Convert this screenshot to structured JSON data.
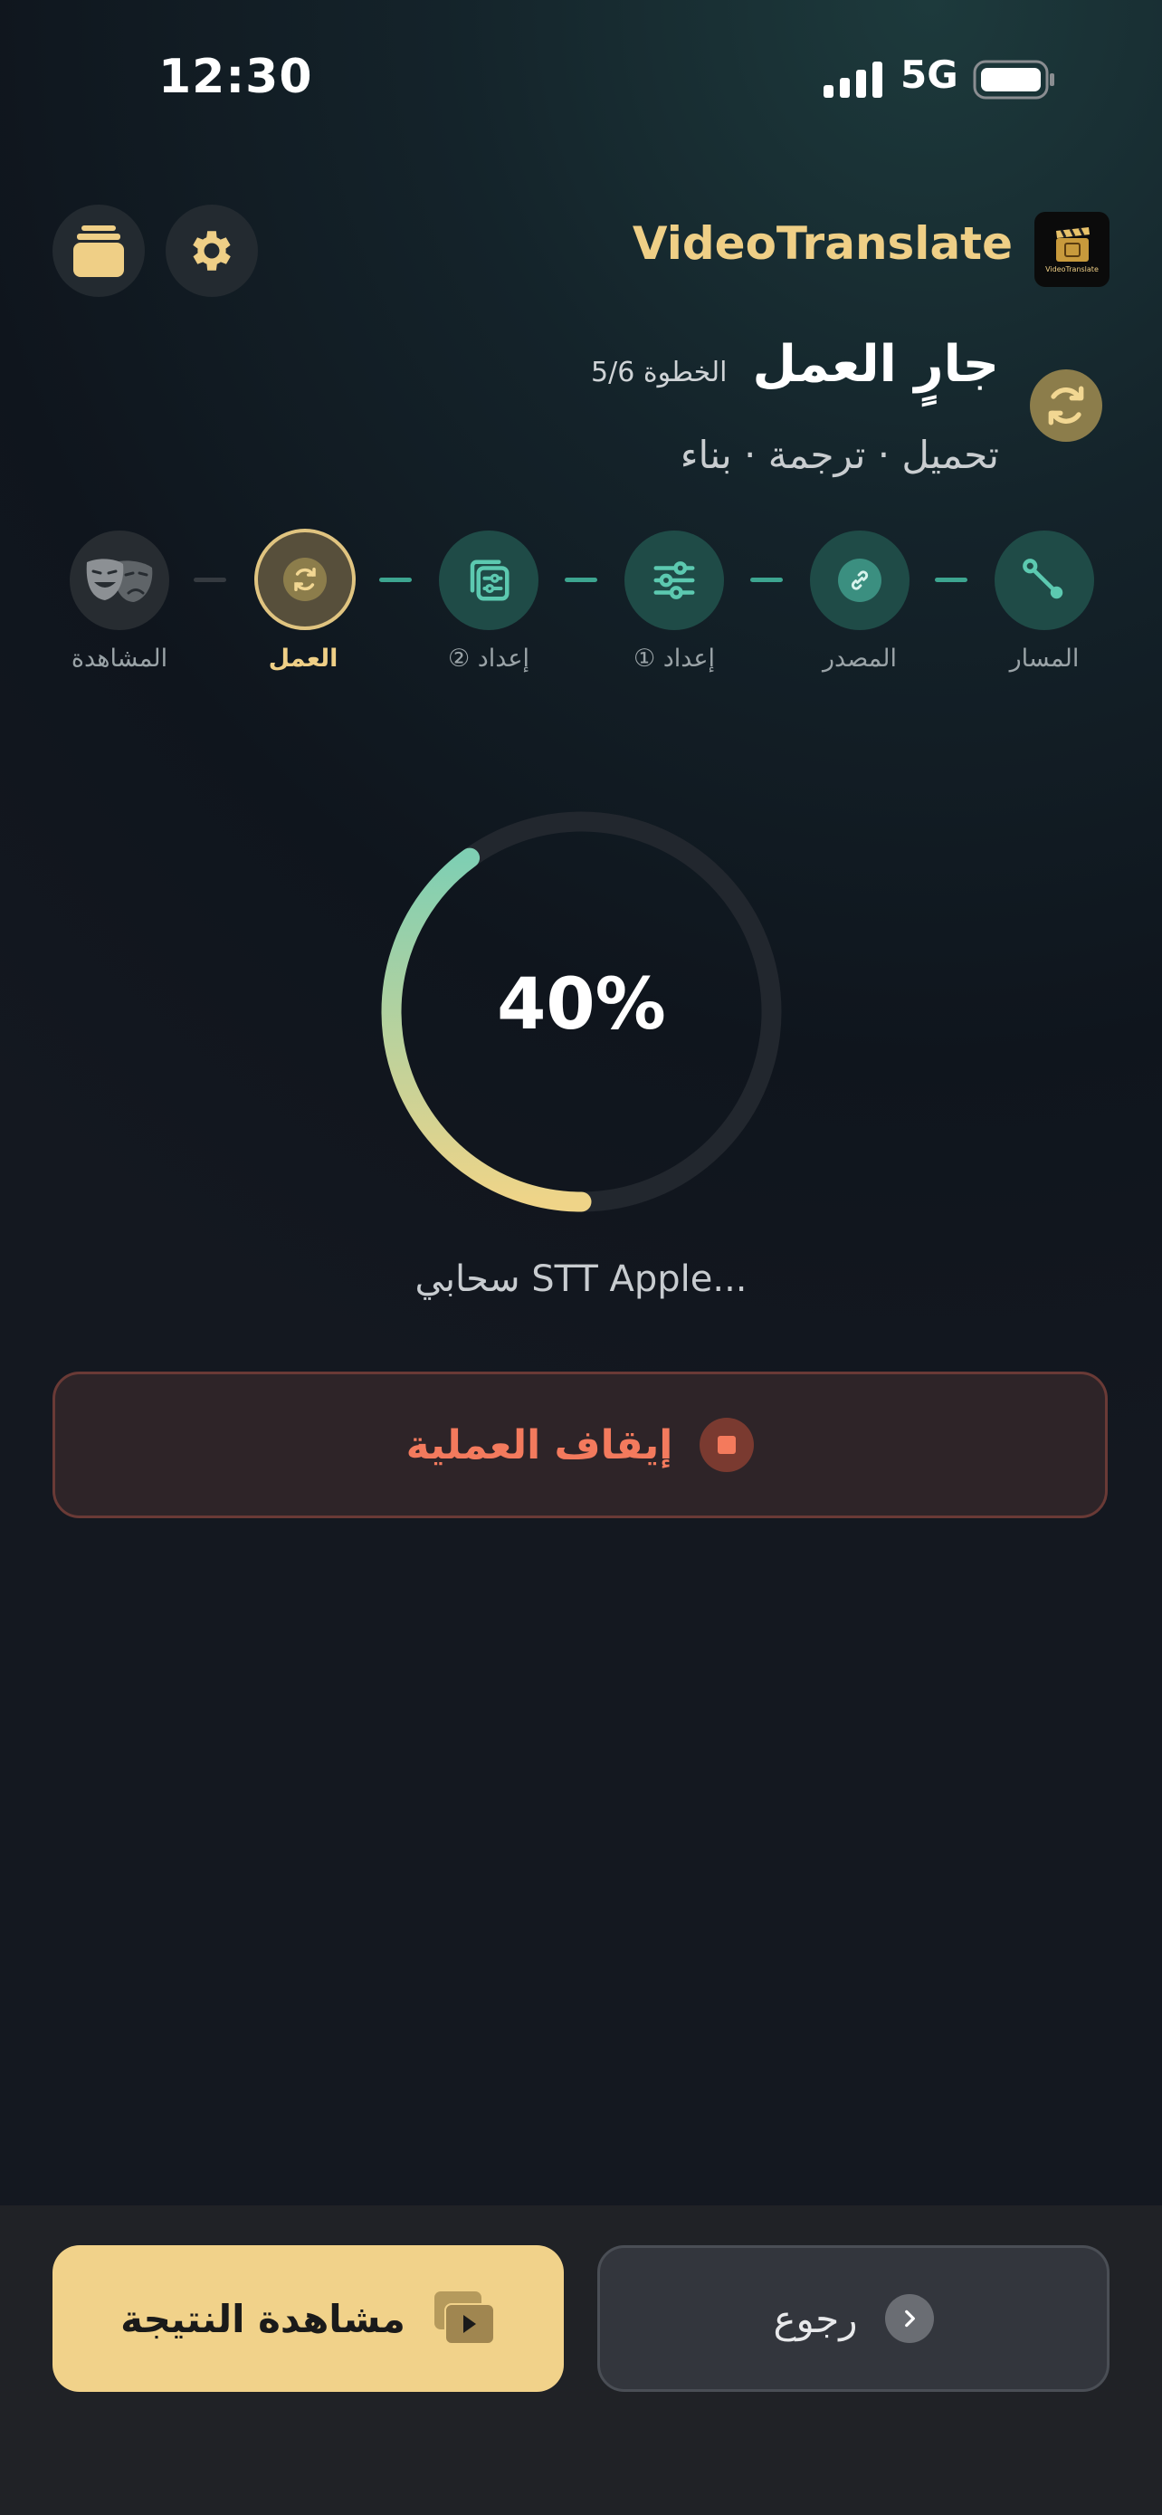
{
  "status_bar": {
    "time": "12:30",
    "network": "5G"
  },
  "header": {
    "app_title": "VideoTranslate",
    "logo_text": "VideoTranslate"
  },
  "heading": {
    "title": "جارٍ العمل",
    "step_count": "الخطوة 5/6",
    "subtitle": "تحميل · ترجمة · بناء"
  },
  "stepper": {
    "steps": [
      {
        "label": "المسار",
        "state": "done",
        "icon": "route-icon"
      },
      {
        "label": "المصدر",
        "state": "done",
        "icon": "link-icon"
      },
      {
        "label": "إعداد ①",
        "state": "done",
        "icon": "sliders-icon"
      },
      {
        "label": "إعداد ②",
        "state": "done",
        "icon": "stack-settings-icon"
      },
      {
        "label": "العمل",
        "state": "current",
        "icon": "sync-icon"
      },
      {
        "label": "المشاهدة",
        "state": "future",
        "icon": "theater-masks-icon"
      }
    ]
  },
  "progress": {
    "value": 40,
    "label": "40%",
    "status": "سحابي STT Apple..."
  },
  "actions": {
    "stop_label": "إيقاف العملية",
    "view_result_label": "مشاهدة النتيجة",
    "back_label": "رجوع"
  },
  "colors": {
    "accent_gold": "#efcf86",
    "accent_teal": "#3da590",
    "danger": "#f37a5d",
    "background": "#0f151d"
  }
}
